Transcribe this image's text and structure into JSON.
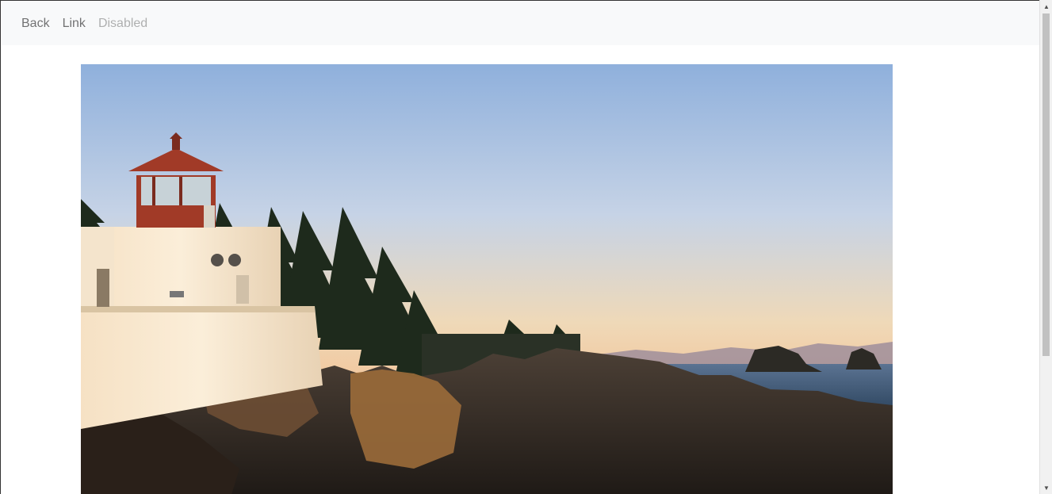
{
  "nav": {
    "items": [
      {
        "label": "Back",
        "state": "active"
      },
      {
        "label": "Link",
        "state": "active"
      },
      {
        "label": "Disabled",
        "state": "disabled"
      }
    ]
  },
  "hero": {
    "subject": "lighthouse-at-sunset-photo"
  },
  "scrollbar": {
    "up_icon": "▲",
    "down_icon": "▼"
  }
}
